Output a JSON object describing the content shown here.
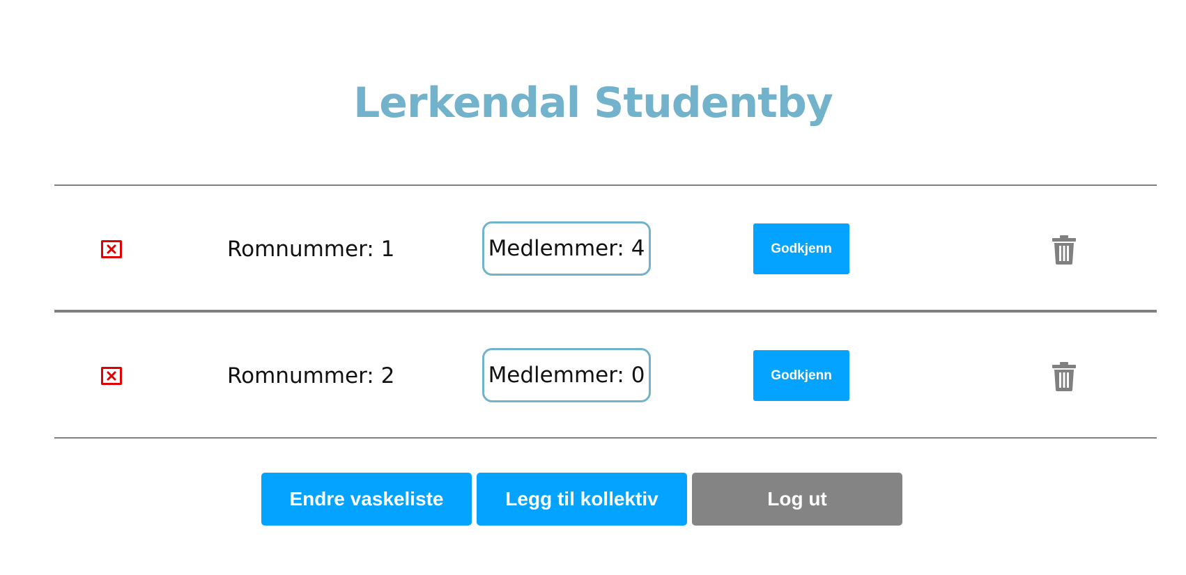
{
  "header": {
    "title": "Lerkendal Studentby"
  },
  "rooms": [
    {
      "status_icon": "close-box-icon",
      "room_label": "Romnummer: 1",
      "members_label": "Medlemmer: 4",
      "approve_label": "Godkjenn",
      "delete_icon": "trash-icon"
    },
    {
      "status_icon": "close-box-icon",
      "room_label": "Romnummer: 2",
      "members_label": "Medlemmer: 0",
      "approve_label": "Godkjenn",
      "delete_icon": "trash-icon"
    }
  ],
  "actions": {
    "edit_laundry_label": "Endre vaskeliste",
    "add_collective_label": "Legg til kollektiv",
    "logout_label": "Log ut"
  },
  "colors": {
    "title": "#72b2cb",
    "primary_button": "#03a3ff",
    "secondary_button": "#848484",
    "status_icon": "#e00000",
    "trash_icon": "#808080",
    "divider": "#808080"
  }
}
